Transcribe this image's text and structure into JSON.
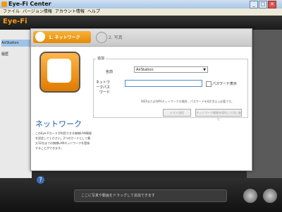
{
  "window": {
    "title": "Eye-Fi Center",
    "minimize": "_",
    "maximize": "□",
    "close": "✕"
  },
  "menu": [
    "ファイル",
    "バージョン情報",
    "アカウント情報",
    "ヘルプ"
  ],
  "app": {
    "logo": "Eye-Fi"
  },
  "sidebar": {
    "items": [
      {
        "label": "AirStation"
      },
      {
        "label": "履歴"
      }
    ]
  },
  "dialog": {
    "steps": [
      {
        "label": "1. ネットワーク"
      },
      {
        "label": "2. 写真"
      }
    ],
    "left": {
      "title": "ネットワーク",
      "description": "このEye-Fiカードが利用できる無線LAN情報を設定してください。2つのカードとして最大32台までの無線LANネットワークを登録することができます。",
      "help": "?"
    },
    "form": {
      "group_title": "追加",
      "name_label": "名前",
      "network_value": "AirStation",
      "password_label": "ネットワークパスワード",
      "password_value": "",
      "show_password_label": "パスワード表示",
      "note": "WEPまたはWPAネットワークの場合、パスワードを8文字以上必要です。",
      "button_test": "テスト送信",
      "button_save": "ネットワーク情報を保存して次に進む"
    }
  },
  "bottom": {
    "hint": "ここに写真や動画をドラッグして追加できます"
  },
  "colors": {
    "accent": "#f39a12",
    "title_blue": "#1e5aa6"
  }
}
